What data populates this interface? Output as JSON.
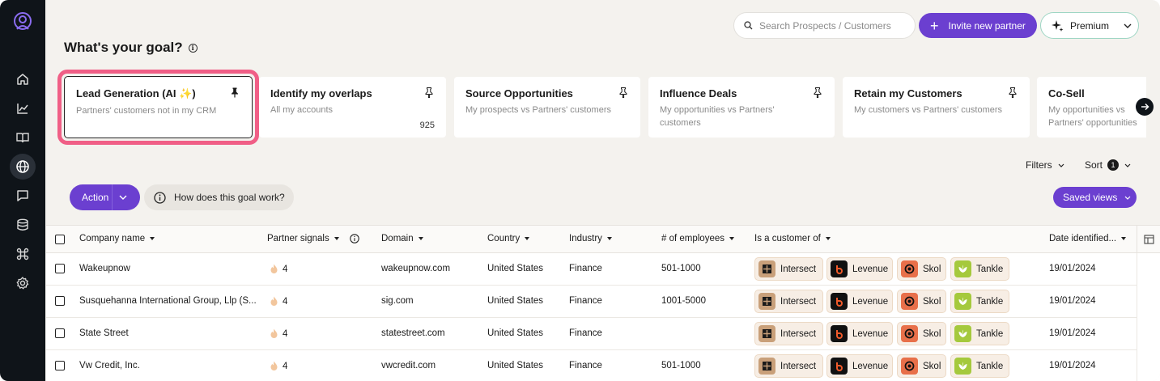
{
  "header": {
    "search_placeholder": "Search Prospects / Customers",
    "invite_label": "Invite new partner",
    "premium_label": "Premium"
  },
  "page": {
    "title": "What's your goal?"
  },
  "goals": [
    {
      "title": "Lead Generation (AI ",
      "spark": "✨",
      "title_end": ")",
      "desc": "Partners' customers not in my CRM",
      "count": ""
    },
    {
      "title": "Identify my overlaps",
      "desc": "All my accounts",
      "count": "925"
    },
    {
      "title": "Source Opportunities",
      "desc": "My prospects vs Partners' customers",
      "count": ""
    },
    {
      "title": "Influence Deals",
      "desc": "My opportunities vs Partners' customers",
      "count": ""
    },
    {
      "title": "Retain my Customers",
      "desc": "My customers vs Partners' customers",
      "count": ""
    },
    {
      "title": "Co-Sell",
      "desc": "My opportunities vs Partners' opportunities",
      "count": ""
    }
  ],
  "toolbar": {
    "filters_label": "Filters",
    "sort_label": "Sort",
    "sort_count": "1",
    "action_label": "Action",
    "how_label": "How does this goal work?",
    "saved_views_label": "Saved views"
  },
  "table": {
    "columns": [
      "Company name",
      "Partner signals",
      "Domain",
      "Country",
      "Industry",
      "# of employees",
      "Is a customer of",
      "Date identified..."
    ],
    "rows": [
      {
        "company": "Wakeupnow",
        "signals": "4",
        "domain": "wakeupnow.com",
        "country": "United States",
        "industry": "Finance",
        "employees": "501-1000",
        "date": "19/01/2024"
      },
      {
        "company": "Susquehanna International Group, Llp (S...",
        "signals": "4",
        "domain": "sig.com",
        "country": "United States",
        "industry": "Finance",
        "employees": "1001-5000",
        "date": "19/01/2024"
      },
      {
        "company": "State Street",
        "signals": "4",
        "domain": "statestreet.com",
        "country": "United States",
        "industry": "Finance",
        "employees": "",
        "date": "19/01/2024"
      },
      {
        "company": "Vw Credit, Inc.",
        "signals": "4",
        "domain": "vwcredit.com",
        "country": "United States",
        "industry": "Finance",
        "employees": "501-1000",
        "date": "19/01/2024"
      }
    ],
    "partners": [
      "Intersect",
      "Levenue",
      "Skol",
      "Tankle"
    ]
  },
  "colors": {
    "accent": "#6b3fd0",
    "sidebar": "#0f1419",
    "highlight": "#f05f86",
    "background": "#f4f2ee"
  }
}
